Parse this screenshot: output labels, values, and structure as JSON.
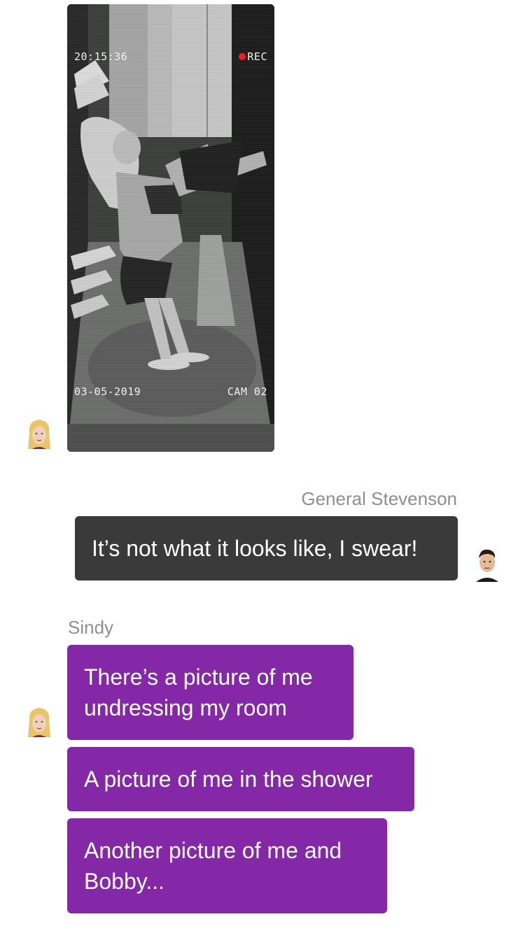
{
  "camera_frame": {
    "time": "20:15:36",
    "rec_label": "REC",
    "date": "03-05-2019",
    "cam_label": "CAM 02",
    "rec_color": "#ff1a1a"
  },
  "messages": [
    {
      "sender": "General Stevenson",
      "text": "It’s not what it looks like, I swear!",
      "bubble_color": "#3a3a3a"
    },
    {
      "sender": "Sindy",
      "bubble_color": "#8428a8",
      "texts": [
        "There’s a picture of me undressing my room",
        "A picture of me in the shower",
        "Another picture of me and Bobby..."
      ]
    }
  ],
  "avatars": {
    "sindy": "blonde-woman-avatar",
    "stevenson": "dark-haired-man-avatar"
  }
}
